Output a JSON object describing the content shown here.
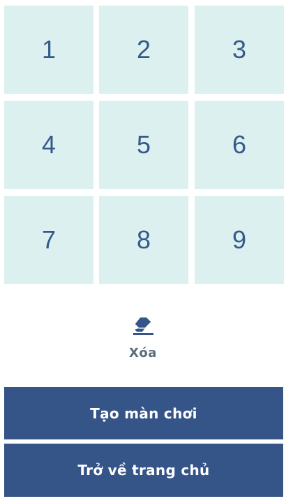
{
  "keypad": {
    "keys": [
      "1",
      "2",
      "3",
      "4",
      "5",
      "6",
      "7",
      "8",
      "9"
    ]
  },
  "erase": {
    "icon": "eraser-icon",
    "label": "Xóa"
  },
  "actions": {
    "create_game_label": "Tạo màn chơi",
    "back_home_label": "Trở về trang chủ"
  },
  "colors": {
    "key_background": "#dbf0ef",
    "key_text": "#355a8a",
    "button_background": "#355488",
    "button_text": "#ffffff",
    "erase_label": "#5a6b7a"
  }
}
